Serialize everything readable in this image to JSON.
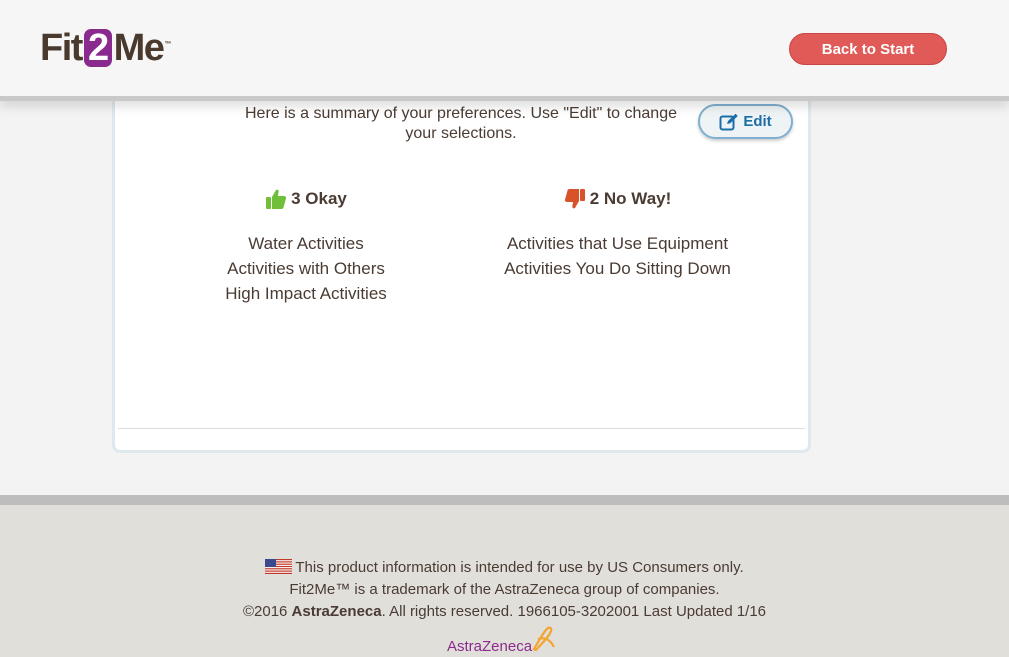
{
  "header": {
    "logo": {
      "part1": "Fit",
      "part2": "2",
      "part3": "Me",
      "tm": "™"
    },
    "back_button": "Back to Start"
  },
  "summary": {
    "intro": "Here is a summary of your preferences. Use \"Edit\" to change your selections.",
    "edit_label": "Edit"
  },
  "okay": {
    "heading": "3 Okay",
    "icon": "thumbs-up-icon",
    "color": "#6fbf3a",
    "items": [
      "Water Activities",
      "Activities with Others",
      "High Impact Activities"
    ]
  },
  "no_way": {
    "heading": "2 No Way!",
    "icon": "thumbs-down-icon",
    "color": "#d9532a",
    "items": [
      "Activities that Use Equipment",
      "Activities You Do Sitting Down"
    ]
  },
  "footer": {
    "line1": "This product information is intended for use by US Consumers only.",
    "line2": "Fit2Me™ is a trademark of the AstraZeneca group of companies.",
    "line3_prefix": "©2016 ",
    "line3_company": "AstraZeneca",
    "line3_suffix": ". All rights reserved. 1966105-3202001 Last Updated 1/16",
    "brand": "AstraZeneca"
  },
  "colors": {
    "brand_purple": "#8b2a8e",
    "back_button": "#e05a57",
    "edit_blue": "#1d6ea8"
  }
}
